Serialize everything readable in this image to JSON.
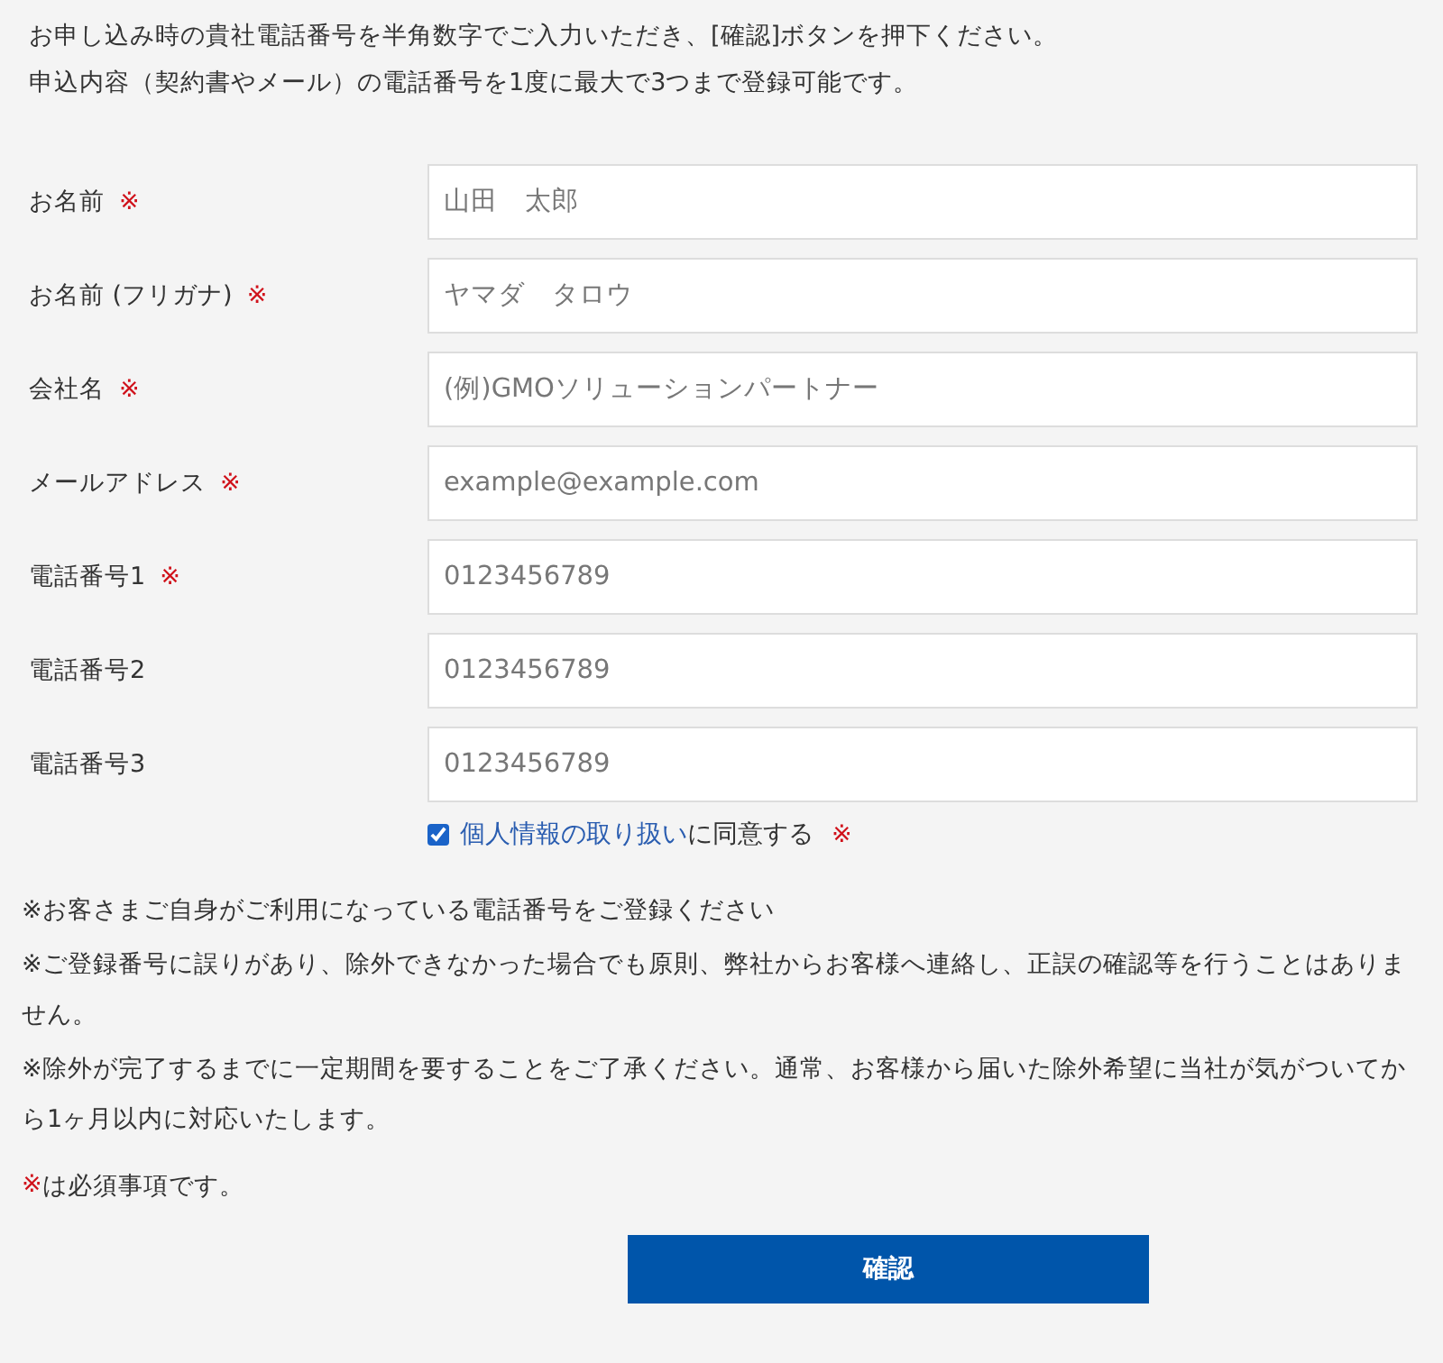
{
  "intro": [
    "お申し込み時の貴社電話番号を半角数字でご入力いただき、[確認]ボタンを押下ください。",
    "申込内容（契約書やメール）の電話番号を1度に最大で3つまで登録可能です。"
  ],
  "fields": [
    {
      "label": "お名前",
      "required_mark": "※",
      "placeholder": "山田　太郎"
    },
    {
      "label": "お名前 (フリガナ)",
      "required_mark": "※",
      "placeholder": "ヤマダ　タロウ"
    },
    {
      "label": "会社名",
      "required_mark": "※",
      "placeholder": "(例)GMOソリューションパートナー"
    },
    {
      "label": "メールアドレス",
      "required_mark": "※",
      "placeholder": "example@example.com"
    },
    {
      "label": "電話番号1",
      "required_mark": "※",
      "placeholder": "0123456789"
    },
    {
      "label": "電話番号2",
      "placeholder": "0123456789"
    },
    {
      "label": "電話番号3",
      "placeholder": "0123456789"
    }
  ],
  "consent": {
    "checked": true,
    "link": "個人情報の取り扱い",
    "text": "に同意する",
    "required_mark": "※"
  },
  "notes": [
    "※お客さまご自身がご利用になっている電話番号をご登録ください",
    "※ご登録番号に誤りがあり、除外できなかった場合でも原則、弊社からお客様へ連絡し、正誤の確認等を行うことはありません。",
    "※除外が完了するまでに一定期間を要することをご了承ください。通常、お客様から届いた除外希望に当社が気がついてから1ヶ月以内に対応いたします。"
  ],
  "legend": {
    "mark": "※",
    "text": "は必須事項です。"
  },
  "submit_button": "確認"
}
